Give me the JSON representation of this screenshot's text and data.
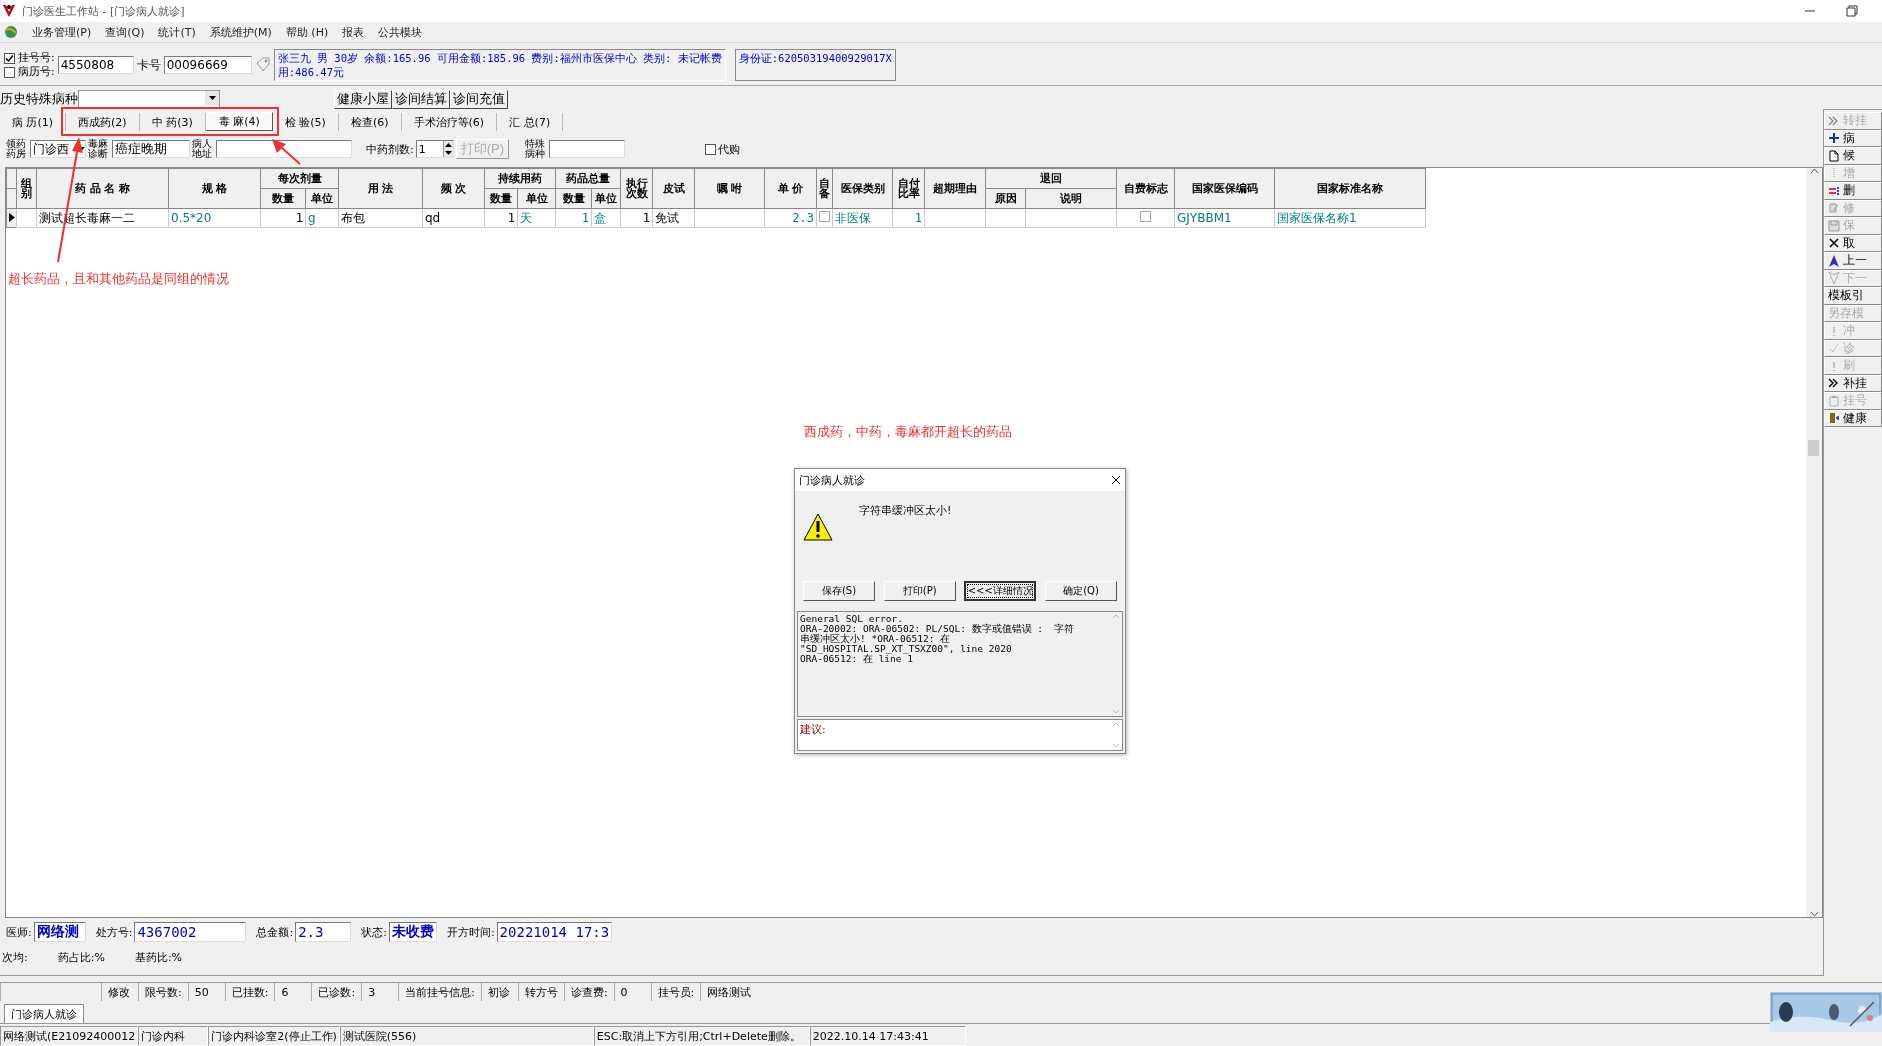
{
  "window": {
    "title": "门诊医生工作站 - [门诊病人就诊]"
  },
  "menu": [
    "业务管理(P)",
    "查询(Q)",
    "统计(T)",
    "系统维护(M)",
    "帮助 (H)",
    "报表",
    "公共模块"
  ],
  "patient": {
    "lookup_options": [
      {
        "label": "挂号号:",
        "checked": true
      },
      {
        "label": "病历号:",
        "checked": false
      }
    ],
    "registration_value": "4550808",
    "card_label": "卡号",
    "card_value": "00096669",
    "info_lines": [
      "张三九 男 30岁 余额:165.96 可用金额:185.96 费别:福州市医保中心 类别: 未记帐费",
      "用:486.47元"
    ],
    "id_card": "身份证:62050319400929017X"
  },
  "history": {
    "label": "历史特殊病种",
    "buttons": [
      "健康小屋",
      "诊间结算",
      "诊间充值"
    ]
  },
  "tabs": [
    {
      "label": "病 历(1)",
      "selected": false
    },
    {
      "label": "西成药(2)",
      "selected": false
    },
    {
      "label": "中 药(3)",
      "selected": false
    },
    {
      "label": "毒 麻(4)",
      "selected": true
    },
    {
      "label": "检 验(5)",
      "selected": false
    },
    {
      "label": "检查(6)",
      "selected": false
    },
    {
      "label": "手术治疗等(6)",
      "selected": false
    },
    {
      "label": "汇 总(7)",
      "selected": false
    }
  ],
  "form": {
    "pharmacy_label": "领药药房",
    "pharmacy_value": "门诊西",
    "diagnosis_label": "毒麻诊断",
    "diagnosis_value": "癌症晚期",
    "address_label": "病人地址",
    "doses_label": "中药剂数:",
    "doses_value": "1",
    "print_button": {
      "label": "打印(P)",
      "disabled": true
    },
    "special_label": "特殊病种",
    "proxy": {
      "label": "代购",
      "checked": false
    }
  },
  "table": {
    "columns": [
      {
        "label": "组别"
      },
      {
        "label": "药 品 名 称"
      },
      {
        "label": "规  格"
      },
      {
        "label": "每次剂量",
        "colspan": 2,
        "children": [
          "数量",
          "单位"
        ]
      },
      {
        "label": "用 法"
      },
      {
        "label": "频 次"
      },
      {
        "label": "持续用药",
        "colspan": 2,
        "children": [
          "数量",
          "单位"
        ]
      },
      {
        "label": "药品总量",
        "colspan": 2,
        "children": [
          "数量",
          "单位"
        ]
      },
      {
        "label": "执行次数"
      },
      {
        "label": "皮试"
      },
      {
        "label": "嘱  咐"
      },
      {
        "label": "单 价"
      },
      {
        "label": "自备"
      },
      {
        "label": "医保类别"
      },
      {
        "label": "自付比率"
      },
      {
        "label": "超期理由"
      },
      {
        "label": "退回",
        "colspan": 2,
        "children": [
          "原因",
          "说明"
        ]
      },
      {
        "label": "自费标志"
      },
      {
        "label": "国家医保编码"
      },
      {
        "label": "国家标准名称"
      }
    ],
    "rows": [
      {
        "current": true,
        "cells": [
          null,
          "测试超长毒麻一二",
          "0.5*20",
          "1",
          "g",
          "布包",
          "qd",
          "1",
          "天",
          "1",
          "盒",
          "1",
          "免试",
          null,
          "2.3",
          {
            "kind": "checkbox",
            "checked": false
          },
          "非医保",
          "1",
          null,
          null,
          null,
          {
            "kind": "checkbox",
            "checked": false
          },
          "GJYBBM1",
          "国家医保名称1"
        ]
      }
    ]
  },
  "annotations": [
    {
      "text": "超长药品，且和其他药品是同组的情况"
    },
    {
      "text": "西成药，中药，毒麻都开超长的药品"
    }
  ],
  "toolbar": [
    {
      "label": "转挂",
      "disabled": true
    },
    {
      "label": "病",
      "disabled": false
    },
    {
      "label": "候",
      "disabled": false
    },
    {
      "label": "增",
      "disabled": true
    },
    {
      "label": "删",
      "disabled": false
    },
    {
      "label": "修",
      "disabled": true
    },
    {
      "label": "保",
      "disabled": true
    },
    {
      "label": "取",
      "disabled": false
    },
    {
      "label": "上一",
      "disabled": false
    },
    {
      "label": "下一",
      "disabled": true
    },
    {
      "label": "模板引",
      "disabled": false
    },
    {
      "label": "另存模",
      "disabled": true
    },
    {
      "label": "冲",
      "disabled": true
    },
    {
      "label": "诊",
      "disabled": true
    },
    {
      "label": "刷",
      "disabled": true
    },
    {
      "label": "补挂",
      "disabled": false
    },
    {
      "label": "挂号",
      "disabled": true
    },
    {
      "label": "健康",
      "disabled": false
    }
  ],
  "prescription": {
    "fields": [
      {
        "label": "医师:",
        "value": "网络测"
      },
      {
        "label": "处方号:",
        "value": "4367002"
      },
      {
        "label": "总金额:",
        "value": "2.3"
      },
      {
        "label": "状态:",
        "value": "未收费"
      },
      {
        "label": "开方时间:",
        "value": "20221014 17:3"
      }
    ],
    "stats": [
      "次均:",
      "药占比:%",
      "基药比:%"
    ]
  },
  "status_row": [
    "修改",
    "限号数:",
    "50",
    "已挂数:",
    "6",
    "已诊数:",
    "3",
    "当前挂号信息:",
    "初诊",
    "转方号",
    "诊查费:",
    "0",
    "挂号员:",
    "网络测试"
  ],
  "window_tabs": [
    {
      "label": "门诊病人就诊",
      "selected": true
    }
  ],
  "status_bar": [
    "网络测试(E21092400012",
    "门诊内科",
    "门诊内科诊室2(停止工作)",
    "测试医院(556)",
    "ESC:取消上下方引用;Ctrl+Delete删除。",
    "2022.10.14 17:43:41"
  ],
  "dialog": {
    "title": "门诊病人就诊",
    "message": "字符串缓冲区太小!",
    "buttons": [
      {
        "label": "保存(S)",
        "focused": false
      },
      {
        "label": "打印(P)",
        "focused": false
      },
      {
        "label": "<<<详细情况",
        "focused": true
      },
      {
        "label": "确定(Q)",
        "focused": false
      }
    ],
    "details": [
      "General SQL error.",
      "ORA-20002: ORA-06502: PL/SQL: 数字或值错误 :  字符",
      "串缓冲区太小! *ORA-06512: 在",
      "\"SD_HOSPITAL.SP_XT_TSXZ00\", line 2020",
      "ORA-06512: 在 line 1"
    ],
    "suggestion_label": "建议:"
  }
}
